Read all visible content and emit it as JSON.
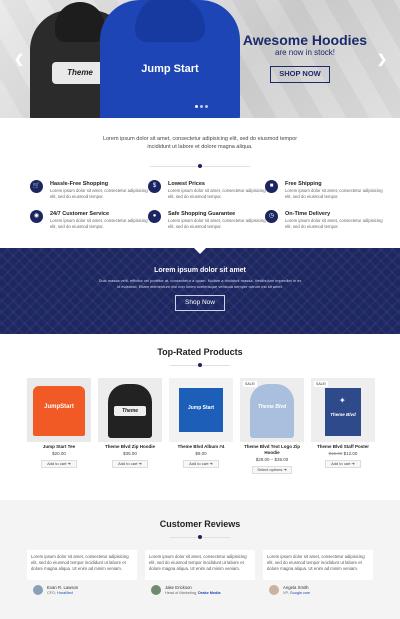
{
  "hero": {
    "title": "Awesome Hoodies",
    "subtitle": "are now in stock!",
    "button": "SHOP NOW",
    "prev_icon": "chevron-left-icon",
    "next_icon": "chevron-right-icon",
    "black_logo": "Theme",
    "blue_logo": "Jump Start"
  },
  "intro": {
    "text": "Lorem ipsum dolor sit amet, consectetur adipisicing elit, sed do eiusmod tempor incididunt ut labore et dolore magna aliqua."
  },
  "features": [
    {
      "title": "Hassle-Free Shopping",
      "desc": "Lorem ipsum dolor sit amet, consectetur adipisicing elit, sed do eiusmod tempor.",
      "icon": "cart-icon"
    },
    {
      "title": "Lowest Prices",
      "desc": "Lorem ipsum dolor sit amet, consectetur adipisicing elit, sed do eiusmod tempor.",
      "icon": "dollar-icon"
    },
    {
      "title": "Free Shipping",
      "desc": "Lorem ipsum dolor sit amet, consectetur adipisicing elit, sed do eiusmod tempor.",
      "icon": "truck-icon"
    },
    {
      "title": "24/7 Customer Service",
      "desc": "Lorem ipsum dolor sit amet, consectetur adipisicing elit, sed do eiusmod tempor.",
      "icon": "headset-icon"
    },
    {
      "title": "Safe Shopping Guarantee",
      "desc": "Lorem ipsum dolor sit amet, consectetur adipisicing elit, sed do eiusmod tempor.",
      "icon": "lock-icon"
    },
    {
      "title": "On-Time Delivery",
      "desc": "Lorem ipsum dolor sit amet, consectetur adipisicing elit, sed do eiusmod tempor.",
      "icon": "clock-icon"
    }
  ],
  "banner": {
    "title": "Lorem ipsum dolor sit amet",
    "text": "Duis massa velit, efficitur vel porttitor at, consectetur a quam. Nullam a tincidunt massa. Vestibulum imperdiet in ex id euismod. Etiam elementum nisl non lorem scelerisque vehicula semper rutrum est sit amet.",
    "button": "Shop Now"
  },
  "products_section": {
    "title": "Top-Rated Products",
    "items": [
      {
        "name": "Jump Start Tee",
        "price": "$20.00",
        "old_price": "",
        "cta": "Add to cart",
        "sale": "",
        "image": "orange-tee-image",
        "label": "JumpStart"
      },
      {
        "name": "Theme Blvd Zip Hoodie",
        "price": "$35.00",
        "old_price": "",
        "cta": "Add to cart",
        "sale": "",
        "image": "black-hoodie-image",
        "label": "Theme"
      },
      {
        "name": "Theme Blvd Album #4",
        "price": "$9.00",
        "old_price": "",
        "cta": "Add to cart",
        "sale": "",
        "image": "album-image",
        "label": "Jump Start"
      },
      {
        "name": "Theme Blvd Text Logo Zip Hoodie",
        "price": "$28.00 – $35.00",
        "old_price": "",
        "cta": "Select options",
        "sale": "SALE!",
        "image": "blue-hoodie-image",
        "label": "Theme Blvd"
      },
      {
        "name": "Theme Blvd Staff Poster",
        "price": "$12.00",
        "old_price": "$15.00",
        "cta": "Add to cart",
        "sale": "SALE!",
        "image": "poster-image",
        "label": "Theme Blvd"
      }
    ]
  },
  "reviews_section": {
    "title": "Customer Reviews",
    "items": [
      {
        "text": "Lorem ipsum dolor sit amet, consectetur adipisicing elit, sed do eiusmod tempor incididunt ut labore et dolore magna aliqua. Ut enim ad minim veniam.",
        "name": "Evan R. Lawson",
        "role": "CFO, ",
        "company": "HoraMed"
      },
      {
        "text": "Lorem ipsum dolor sit amet, consectetur adipisicing elit, sed do eiusmod tempor incididunt ut labore et dolore magna aliqua. Ut enim ad minim veniam.",
        "name": "Jake Erickson",
        "role": "Head of Marketing, ",
        "company": "Drake Media"
      },
      {
        "text": "Lorem ipsum dolor sit amet, consectetur adipisicing elit, sed do eiusmod tempor incididunt ut labore et dolore magna aliqua. Ut enim ad minim veniam.",
        "name": "Angela Smith",
        "role": "VP, ",
        "company": "Google.com"
      }
    ]
  },
  "colors": {
    "navy": "#1d2761",
    "blue": "#1d45b6"
  }
}
